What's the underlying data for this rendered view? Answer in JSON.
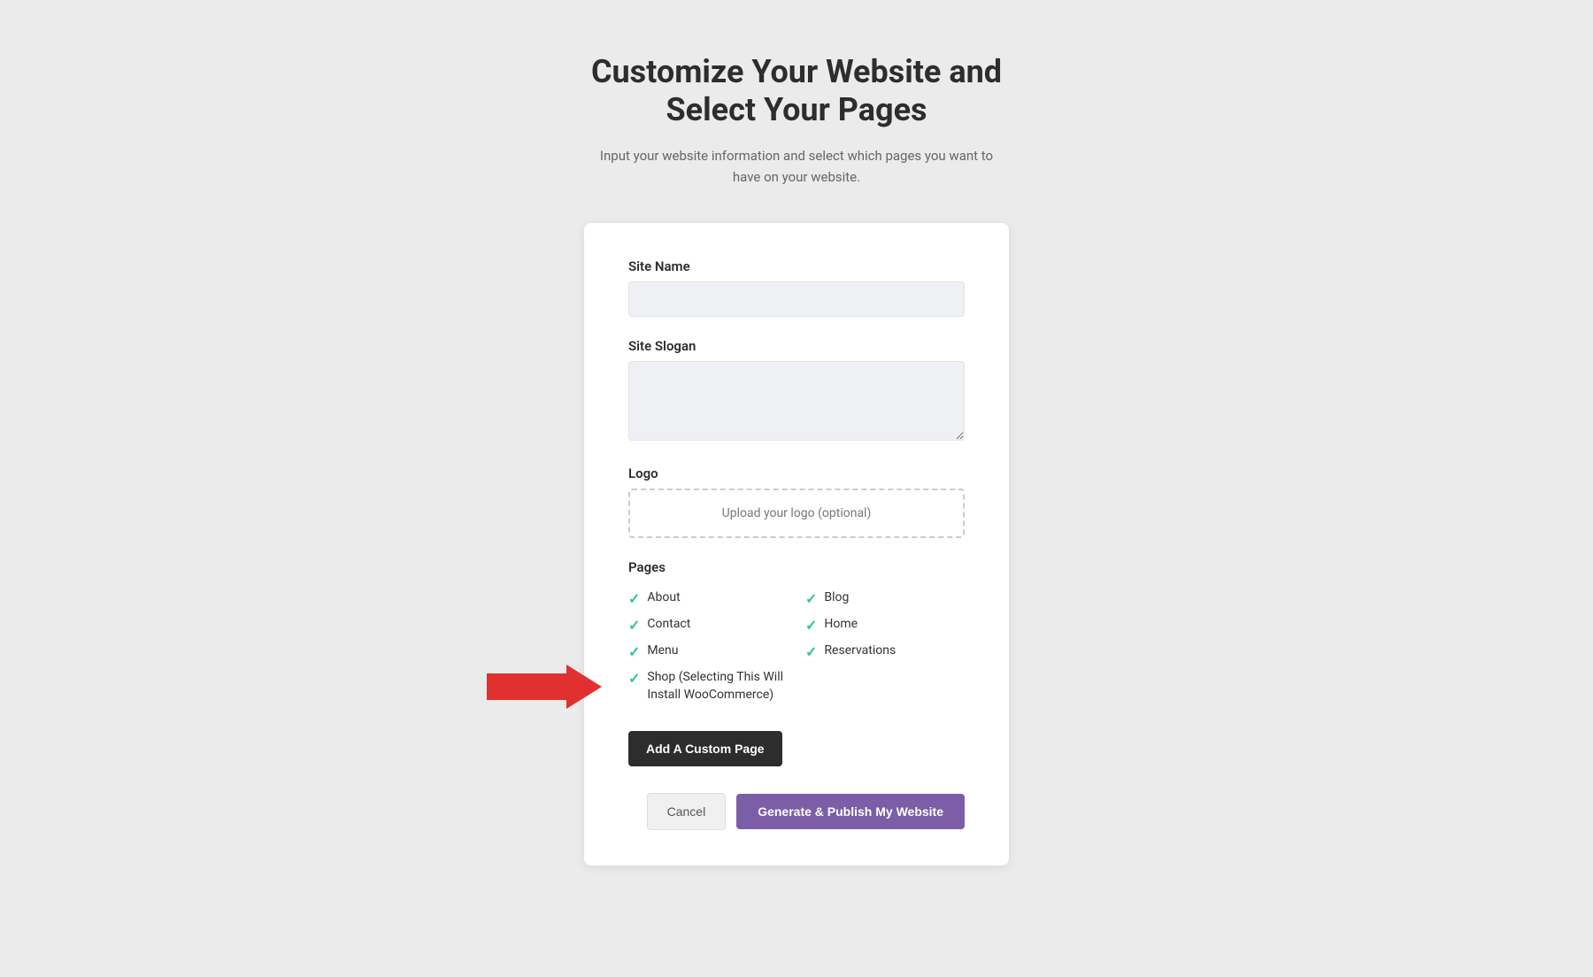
{
  "header": {
    "title": "Customize Your Website and Select Your Pages",
    "subtitle": "Input your website information and select which pages you want to have on your website."
  },
  "form": {
    "site_name_label": "Site Name",
    "site_name_placeholder": "",
    "site_slogan_label": "Site Slogan",
    "site_slogan_placeholder": "",
    "logo_label": "Logo",
    "logo_upload_text": "Upload your logo (optional)",
    "pages_label": "Pages",
    "pages": [
      {
        "label": "About",
        "checked": true,
        "col": 1
      },
      {
        "label": "Blog",
        "checked": true,
        "col": 2
      },
      {
        "label": "Contact",
        "checked": true,
        "col": 1
      },
      {
        "label": "Home",
        "checked": true,
        "col": 2
      },
      {
        "label": "Menu",
        "checked": true,
        "col": 1
      },
      {
        "label": "Reservations",
        "checked": true,
        "col": 2
      },
      {
        "label": "Shop (Selecting This Will Install WooCommerce)",
        "checked": true,
        "col": 1
      }
    ],
    "add_custom_page_btn": "Add A Custom Page",
    "cancel_btn": "Cancel",
    "generate_btn": "Generate & Publish My Website"
  },
  "icons": {
    "check": "✓",
    "arrow": "➤"
  },
  "colors": {
    "check_color": "#2bc4a0",
    "generate_btn_bg": "#7b5ea7",
    "add_btn_bg": "#2d2d2d",
    "arrow_color": "#e03030"
  }
}
